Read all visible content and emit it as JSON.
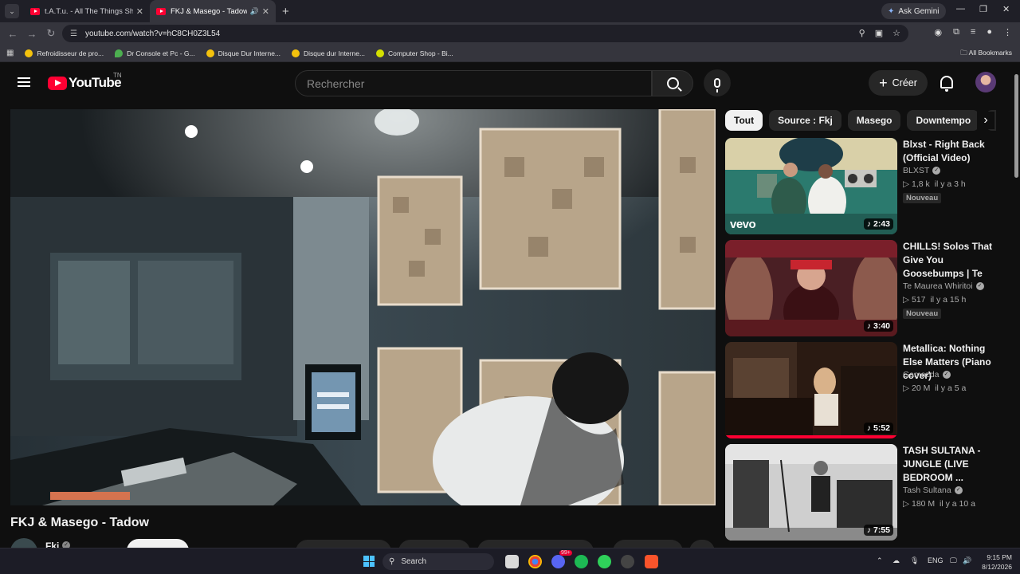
{
  "browser": {
    "tabs": [
      {
        "title": "t.A.T.u. - All The Things She Said",
        "active": false
      },
      {
        "title": "FKJ & Masego - Tadow - YouTube",
        "active": true
      }
    ],
    "ask_gemini": "Ask Gemini",
    "url": "youtube.com/watch?v=hC8CH0Z3L54",
    "bookmarks": [
      "Refroidisseur de pro...",
      "Dr Console et Pc - G...",
      "Disque Dur Interne...",
      "Disque dur Interne...",
      "Computer Shop - Bi..."
    ],
    "all_bookmarks": "All Bookmarks"
  },
  "youtube": {
    "logo_text": "YouTube",
    "country_code": "TN",
    "search_placeholder": "Rechercher",
    "create_label": "Créer"
  },
  "video": {
    "title": "FKJ & Masego - Tadow",
    "channel": "Fkj"
  },
  "chips": [
    "Tout",
    "Source : Fkj",
    "Masego",
    "Downtempo"
  ],
  "recommendations": [
    {
      "title": "Blxst - Right Back (Official Video)",
      "channel": "BLXST",
      "views": "1,8 k",
      "age": "il y a 3 h",
      "badge": "Nouveau",
      "duration": "2:43",
      "brand": "vevo"
    },
    {
      "title": "CHILLS! Solos That Give You Goosebumps | Te Maurea Whiritoi ...",
      "channel": "Te Maurea Whiritoi",
      "views": "517",
      "age": "il y a 15 h",
      "badge": "Nouveau",
      "duration": "3:40"
    },
    {
      "title": "Metallica: Nothing Else Matters (Piano cover)",
      "channel": "Gamazda",
      "views": "20 M",
      "age": "il y a 5 a",
      "duration": "5:52",
      "watched_fraction": 1.0
    },
    {
      "title": "TASH SULTANA - JUNGLE (LIVE BEDROOM ...",
      "channel": "Tash Sultana",
      "views": "180 M",
      "age": "il y a 10 a",
      "duration": "7:55"
    }
  ],
  "taskbar": {
    "search_label": "Search",
    "language": "ENG",
    "time": "9:15 PM",
    "date": "8/12/2026",
    "notification_count": "99+"
  },
  "colors": {
    "youtube_red": "#ff0033",
    "background": "#0f0f0f",
    "chip_active": "#f1f1f1"
  }
}
